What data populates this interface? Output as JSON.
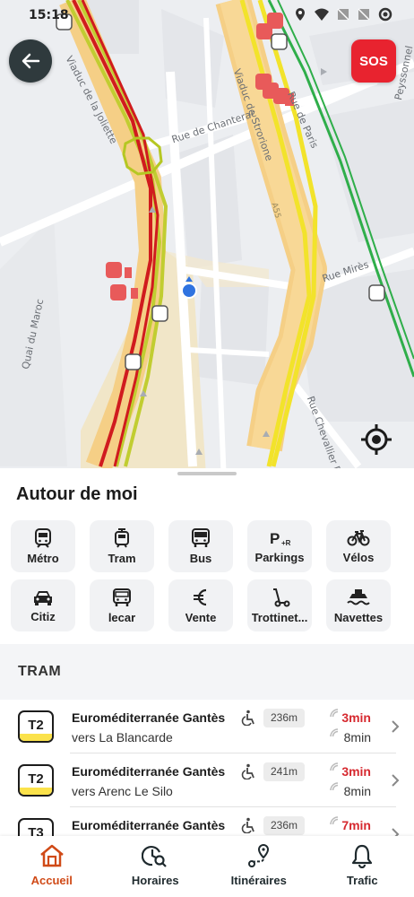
{
  "status_bar": {
    "time": "15:18"
  },
  "map": {
    "sos_label": "SOS",
    "street_labels": {
      "viaduc_joliette": "Viaduc de la Joliette",
      "viaduc_strorione": "Viaduc de Strorione",
      "rue_chanterac": "Rue de Chanterac",
      "rue_paris": "Rue de Paris",
      "peyssonnel": "Peyssonnel",
      "rue_mires": "Rue Mirès",
      "quai_maroc": "Quai du Maroc",
      "rue_chevallier_paul": "Rue Chevallier Paul",
      "a55": "A55"
    }
  },
  "sheet": {
    "title": "Autour de moi",
    "categories": [
      {
        "label": "Métro",
        "icon": "metro-icon"
      },
      {
        "label": "Tram",
        "icon": "tram-icon"
      },
      {
        "label": "Bus",
        "icon": "bus-icon"
      },
      {
        "label": "Parkings",
        "icon": "parking-icon"
      },
      {
        "label": "Vélos",
        "icon": "bike-icon"
      },
      {
        "label": "Citiz",
        "icon": "car-icon"
      },
      {
        "label": "lecar",
        "icon": "lecar-icon"
      },
      {
        "label": "Vente",
        "icon": "euro-icon"
      },
      {
        "label": "Trottinet...",
        "icon": "scooter-icon"
      },
      {
        "label": "Navettes",
        "icon": "ferry-icon"
      }
    ],
    "section_title": "TRAM",
    "departures": [
      {
        "line": "T2",
        "stop": "Euroméditerranée Gantès",
        "direction": "vers La Blancarde",
        "distance": "236m",
        "next": "3min",
        "after": "8min"
      },
      {
        "line": "T2",
        "stop": "Euroméditerranée Gantès",
        "direction": "vers Arenc Le Silo",
        "distance": "241m",
        "next": "3min",
        "after": "8min"
      },
      {
        "line": "T3",
        "stop": "Euroméditerranée Gantès",
        "direction": "",
        "distance": "236m",
        "next": "7min",
        "after": ""
      }
    ]
  },
  "nav": {
    "items": [
      {
        "label": "Accueil",
        "icon": "home-icon",
        "active": true
      },
      {
        "label": "Horaires",
        "icon": "clock-search-icon",
        "active": false
      },
      {
        "label": "Itinéraires",
        "icon": "route-icon",
        "active": false
      },
      {
        "label": "Trafic",
        "icon": "bell-icon",
        "active": false
      }
    ]
  },
  "colors": {
    "accent": "#d04a17",
    "sos": "#e8232f",
    "tram_yellow": "#fbe24b",
    "time_red": "#d6292f"
  }
}
